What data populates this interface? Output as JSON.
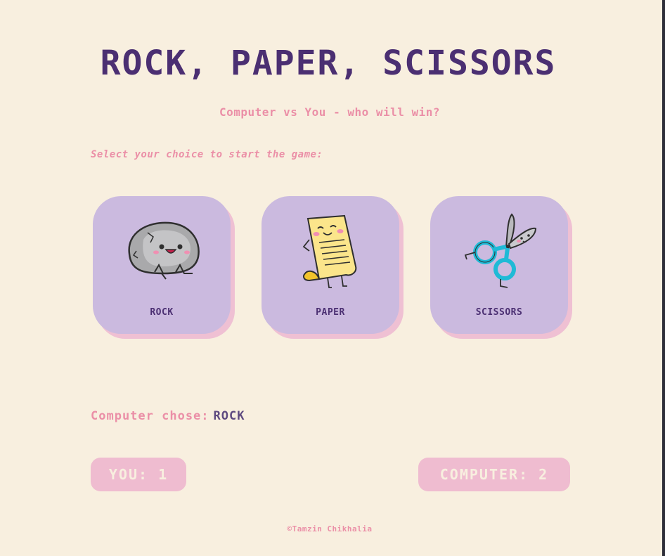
{
  "header": {
    "title": "ROCK, PAPER, SCISSORS",
    "subtitle": "Computer vs You - who will win?",
    "prompt": "Select your choice to start the game:"
  },
  "choices": [
    {
      "label": "ROCK",
      "icon": "rock-icon"
    },
    {
      "label": "PAPER",
      "icon": "paper-icon"
    },
    {
      "label": "SCISSORS",
      "icon": "scissors-icon"
    }
  ],
  "result": {
    "computer_chose_label": "Computer chose:",
    "computer_choice": "ROCK"
  },
  "scores": {
    "you": "YOU: 1",
    "computer": "COMPUTER: 2"
  },
  "footer": {
    "credit": "©Tamzin Chikhalia"
  },
  "colors": {
    "background": "#f8efdf",
    "title": "#4b2f72",
    "accent_pink": "#eb8fa7",
    "card": "#cbbadf",
    "card_shadow": "#efc0d3",
    "score_badge": "#efbcd0"
  }
}
